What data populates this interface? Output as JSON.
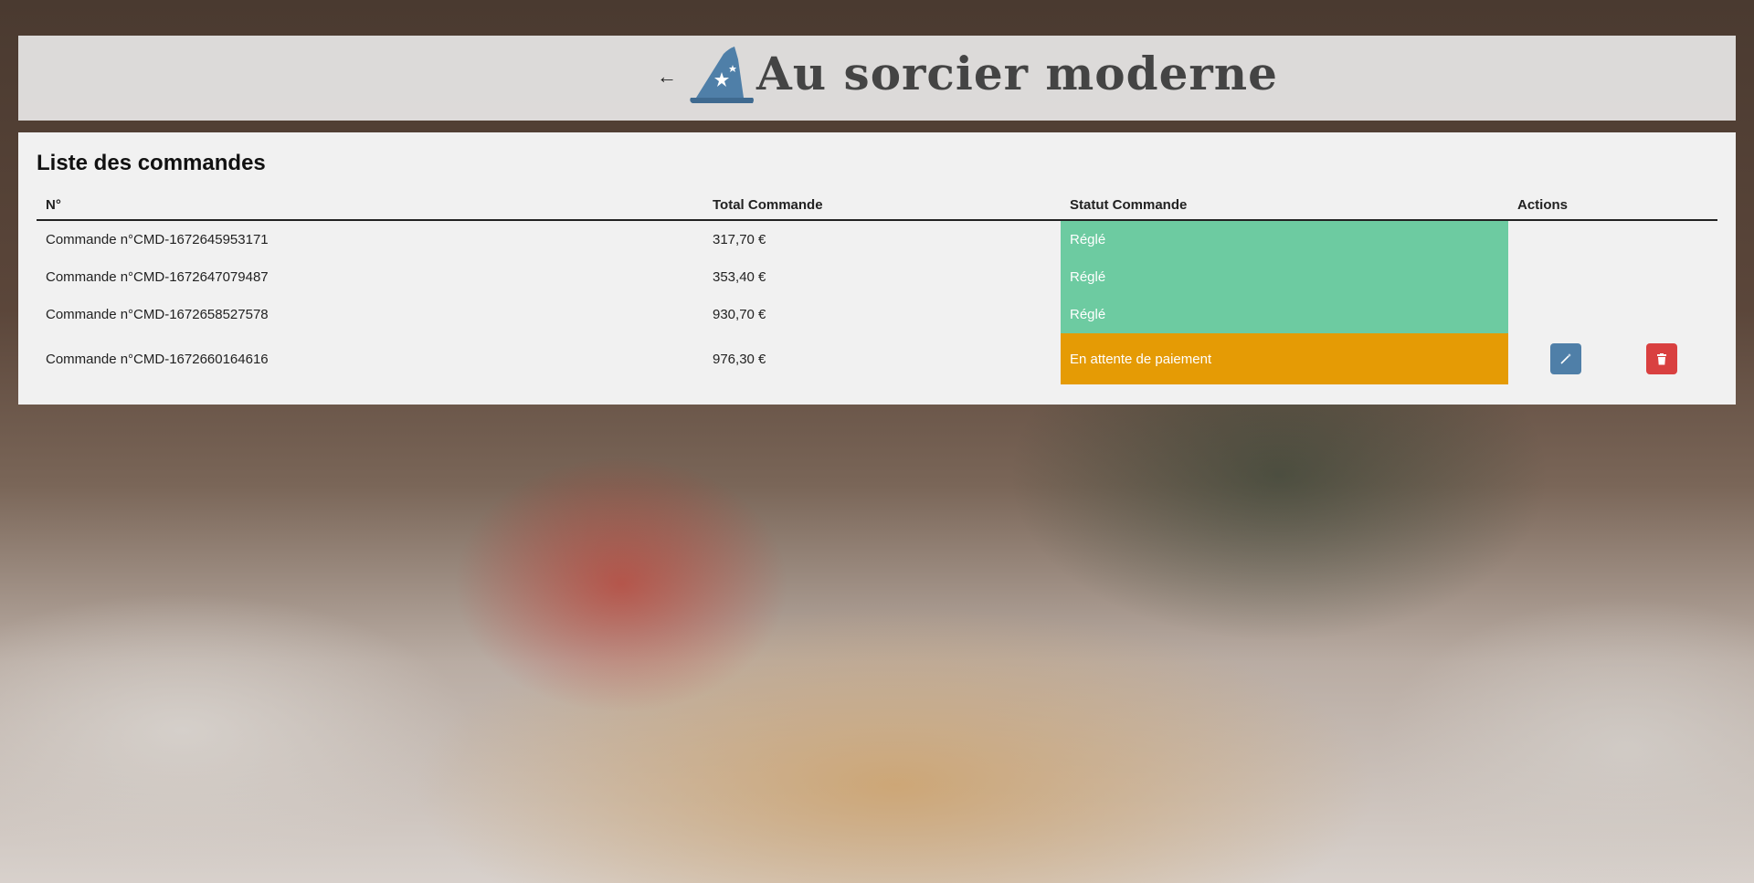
{
  "header": {
    "back_label": "←",
    "brand": "Au sorcier moderne"
  },
  "orders": {
    "title": "Liste des commandes",
    "columns": [
      "N°",
      "Total Commande",
      "Statut Commande",
      "Actions"
    ],
    "rows": [
      {
        "number": "Commande n°CMD-1672645953171",
        "total": "317,70 €",
        "status": "Réglé"
      },
      {
        "number": "Commande n°CMD-1672647079487",
        "total": "353,40 €",
        "status": "Réglé"
      },
      {
        "number": "Commande n°CMD-1672658527578",
        "total": "930,70 €",
        "status": "Réglé"
      },
      {
        "number": "Commande n°CMD-1672660164616",
        "total": "976,30 €",
        "status": "En attente de paiement"
      }
    ],
    "action_icons": [
      "magic-wand-icon",
      "trash-icon"
    ]
  },
  "colors": {
    "paid": "#6dcba1",
    "pending": "#e59b05",
    "edit_button": "#4f7fa8",
    "delete_button": "#d94040",
    "logo": "#4f7fa8"
  }
}
